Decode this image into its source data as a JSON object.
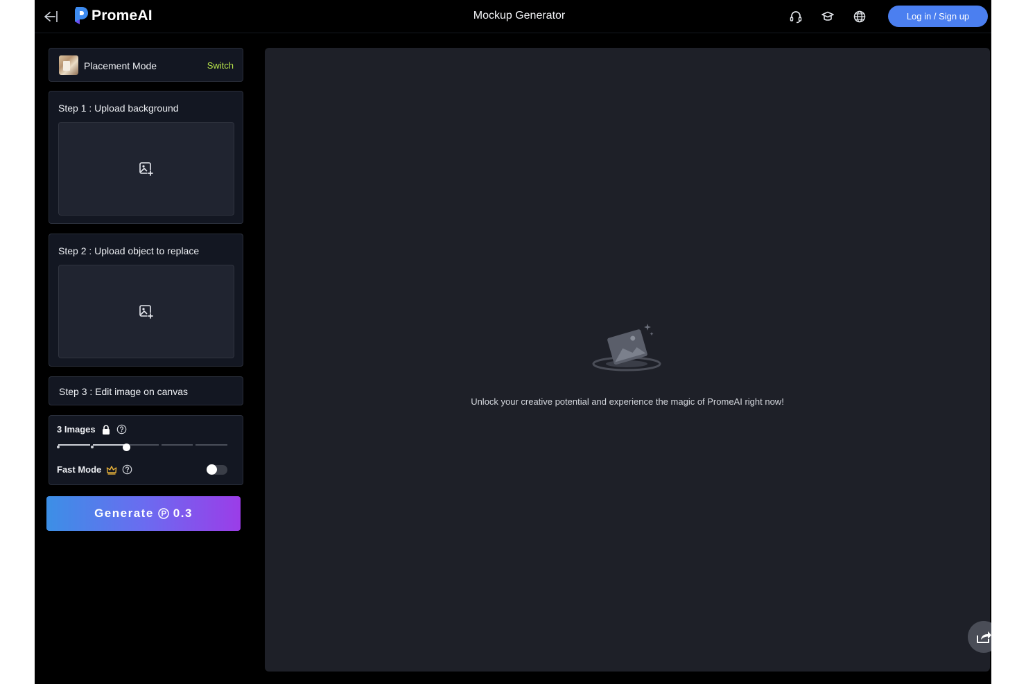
{
  "header": {
    "brand": "PromeAI",
    "title": "Mockup Generator",
    "login_label": "Log in / Sign up",
    "icons": [
      "back-arrow-icon",
      "support-headset-icon",
      "academy-cap-icon",
      "language-globe-icon"
    ]
  },
  "mode": {
    "label": "Placement Mode",
    "switch_label": "Switch"
  },
  "steps": [
    {
      "title": "Step 1 : Upload background"
    },
    {
      "title": "Step 2 : Upload object to replace"
    },
    {
      "title": "Step 3 : Edit image on canvas"
    }
  ],
  "options": {
    "images_label": "3 Images",
    "images_count": 3,
    "images_max": 6,
    "fast_mode_label": "Fast Mode",
    "fast_mode_on": false
  },
  "generate": {
    "label": "Generate",
    "cost": "0.3"
  },
  "canvas": {
    "empty_message": "Unlock your creative potential and experience the magic of PromeAI right now!"
  },
  "colors": {
    "accent_blue": "#4b7ff0",
    "switch_green": "#b6e24a",
    "generate_gradient_start": "#3c8fe6",
    "generate_gradient_end": "#9b3de8",
    "crown_gold": "#e8b23a"
  }
}
